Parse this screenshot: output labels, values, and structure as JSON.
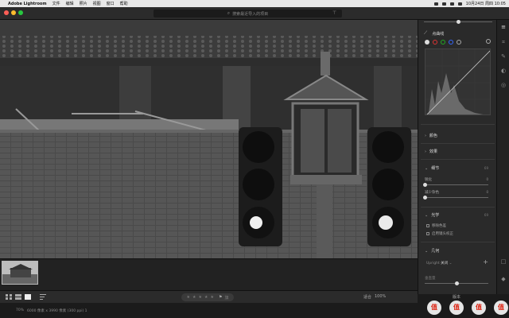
{
  "menubar": {
    "app_name": "Adobe Lightroom",
    "items": [
      "文件",
      "编辑",
      "照片",
      "视图",
      "窗口",
      "帮助"
    ],
    "clock": "10月24日 周四 10:05"
  },
  "titlebar": {
    "search_placeholder": "搜索最近导入的项目"
  },
  "toolbar": {
    "fit_label": "适合",
    "zoom_label": "100%",
    "flag_label": "旗"
  },
  "status": {
    "zoom": "70%",
    "info": "6000 像素 x 3990 像素 (300 ppi) 1"
  },
  "panel": {
    "curve_title": "点曲线",
    "channel_colors": [
      "#dddddd",
      "#d33",
      "#2a2",
      "#36f"
    ],
    "sections": {
      "color": "颜色",
      "effects": "效果",
      "detail": "细节",
      "optics": "光学",
      "geometry": "几何"
    },
    "detail_sub": "69",
    "optics_sub": "69",
    "sharpen_label": "锐化",
    "sharpen_value": "0",
    "noise_label": "减少杂色",
    "noise_value": "0",
    "chk_chromatic": "移除色差",
    "chk_profile": "启用镜头校正",
    "upright_label": "Upright",
    "upright_value": "关闭",
    "vertical_label": "垂直量"
  },
  "bottom_right": {
    "version_label": "版本",
    "badge_text": "值"
  },
  "colors": {
    "accent": "#0a84ff",
    "traffic_red": "#ff5f57",
    "traffic_yellow": "#febc2e",
    "traffic_green": "#28c840"
  }
}
